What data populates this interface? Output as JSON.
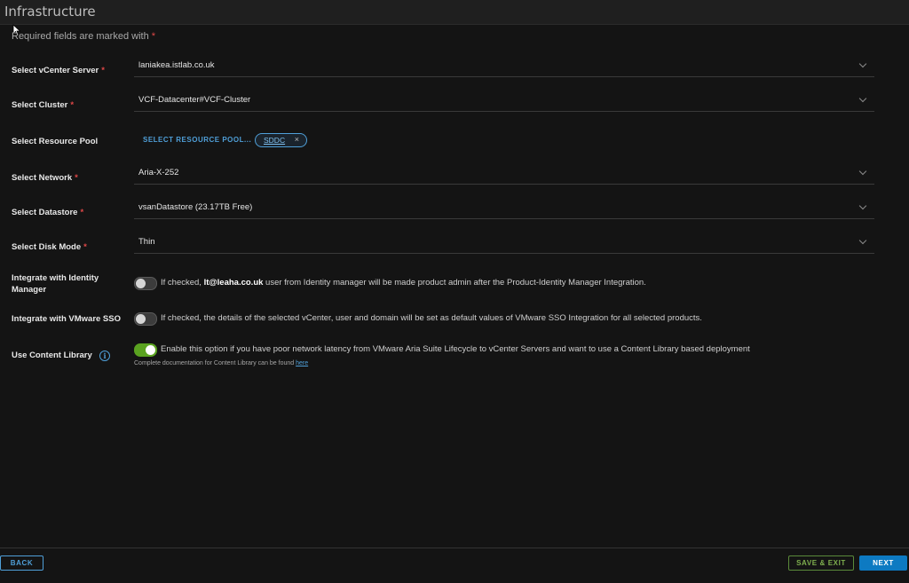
{
  "window": {
    "title": "Infrastructure"
  },
  "form": {
    "required_note": "Required fields are marked with",
    "required_star": "*",
    "fields": {
      "vcenter": {
        "label": "Select vCenter Server",
        "value": "laniakea.istlab.co.uk"
      },
      "cluster": {
        "label": "Select Cluster",
        "value": "VCF-Datacenter#VCF-Cluster"
      },
      "resource_pool": {
        "label": "Select Resource Pool",
        "action": "SELECT RESOURCE POOL...",
        "chip": "SDDC",
        "chip_remove": "×"
      },
      "network": {
        "label": "Select Network",
        "value": "Aria-X-252"
      },
      "datastore": {
        "label": "Select Datastore",
        "value": "vsanDatastore (23.17TB Free)"
      },
      "disk_mode": {
        "label": "Select Disk Mode",
        "value": "Thin"
      }
    },
    "toggles": {
      "identity": {
        "label_line1": "Integrate with Identity",
        "label_line2": "Manager",
        "text_before": "If checked,",
        "user": "lt@leaha.co.uk",
        "text_after": "user from Identity manager will be made product admin after the Product-Identity Manager Integration.",
        "checked": false
      },
      "sso": {
        "label": "Integrate with VMware SSO",
        "text": "If checked, the details of the selected vCenter, user and domain will be set as default values of VMware SSO Integration for all selected products.",
        "checked": false
      },
      "content_library": {
        "label": "Use Content Library",
        "info_icon": "i",
        "text": "Enable this option if you have poor network latency from VMware Aria Suite Lifecycle to vCenter Servers and want to use a Content Library based deployment",
        "checked": true,
        "doc_text": "Complete documentation for Content Library can be found",
        "doc_link": "here"
      }
    }
  },
  "footer": {
    "back": "BACK",
    "save_exit": "SAVE & EXIT",
    "next": "NEXT"
  },
  "colors": {
    "accent": "#4f9fd8",
    "toggle_on": "#5aa220",
    "primary_button": "#0d7ac2",
    "required": "#e04848"
  },
  "icons": {
    "cursor": "mouse-pointer-icon",
    "chevron": "chevron-down-icon",
    "info": "info-icon",
    "close": "close-icon"
  }
}
